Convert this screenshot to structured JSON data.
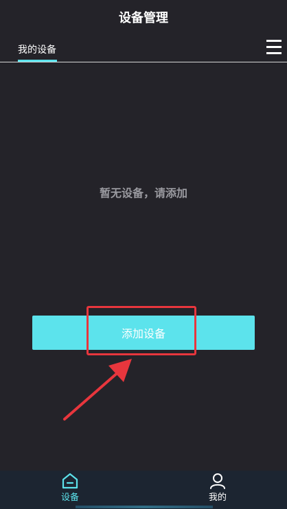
{
  "header": {
    "title": "设备管理",
    "tab_label": "我的设备",
    "menu_icon": "hamburger-menu-icon"
  },
  "main": {
    "empty_message": "暂无设备，请添加",
    "add_button_label": "添加设备"
  },
  "bottom_nav": {
    "items": [
      {
        "label": "设备",
        "icon": "home-icon",
        "active": true
      },
      {
        "label": "我的",
        "icon": "person-icon",
        "active": false
      }
    ]
  },
  "colors": {
    "background": "#242329",
    "accent": "#5ce3ec",
    "annotation": "#e8363d",
    "nav_background": "#1c2531",
    "muted_text": "#9a9aa0"
  }
}
